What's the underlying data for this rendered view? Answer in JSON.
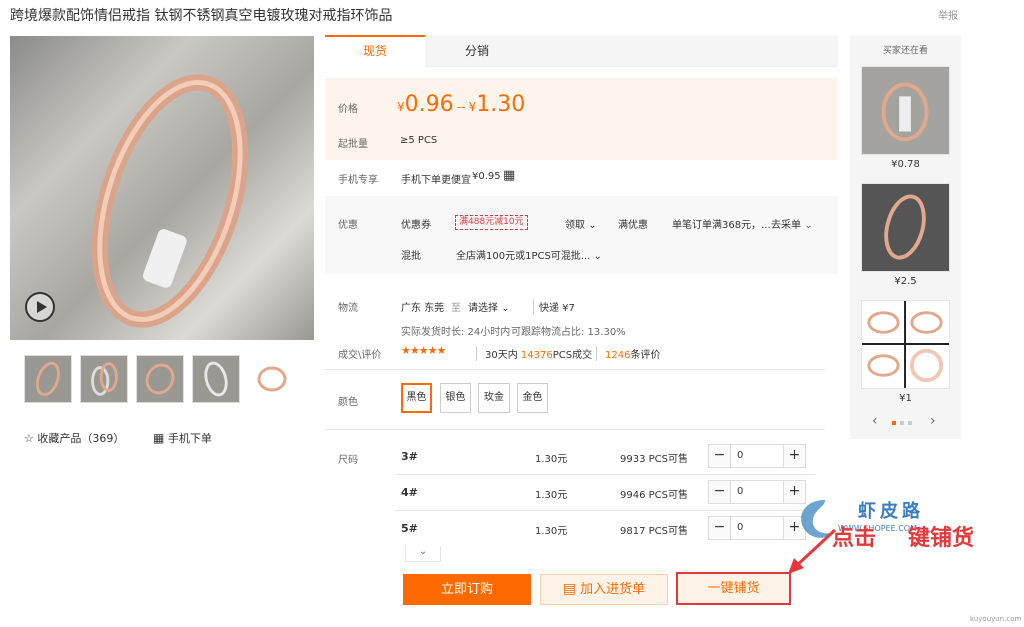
{
  "header": {
    "title": "跨境爆款配饰情侣戒指 钛钢不锈钢真空电镀玫瑰对戒指环饰品",
    "report": "举报"
  },
  "left": {
    "favorite": "收藏产品（369）",
    "mobile_order": "手机下单"
  },
  "tabs": {
    "spot": "现货",
    "distribution": "分销"
  },
  "price": {
    "label": "价格",
    "currency": "¥",
    "low": "0.96",
    "sep": "--",
    "high": "1.30",
    "moq_label": "起批量",
    "moq_value": "≥5 PCS"
  },
  "mobile": {
    "label": "手机专享",
    "text": "手机下单更便宜",
    "price": "¥0.95"
  },
  "promo": {
    "label": "优惠",
    "coupon_label": "优惠券",
    "coupon_tag": "满488元减10元",
    "receive": "领取",
    "discount_label": "满优惠",
    "discount_text": "单笔订单满368元，...",
    "purchase_link": "去采单",
    "mixed_label": "混批",
    "mixed_text": "全店满100元或1PCS可混批..."
  },
  "logistics": {
    "label": "物流",
    "origin": "广东 东莞",
    "to": "至",
    "select": "请选择",
    "express": "快递 ¥7",
    "detail1": "实际发货时长: 24小时内",
    "detail2": "可跟踪物流占比: 13.30%"
  },
  "sales": {
    "label": "成交\\评价",
    "stars": "★★★★★",
    "prefix": "30天内",
    "count": "14376",
    "suffix": "PCS成交",
    "reviews": "1246",
    "reviews_suffix": "条评价"
  },
  "colors": {
    "label": "颜色",
    "options": [
      "黑色",
      "银色",
      "玫金",
      "金色"
    ]
  },
  "sizes": {
    "label": "尺码",
    "rows": [
      {
        "size": "3#",
        "price": "1.30元",
        "stock": "9933 PCS可售",
        "qty": "0"
      },
      {
        "size": "4#",
        "price": "1.30元",
        "stock": "9946 PCS可售",
        "qty": "0"
      },
      {
        "size": "5#",
        "price": "1.30元",
        "stock": "9817 PCS可售",
        "qty": "0"
      }
    ]
  },
  "buttons": {
    "buy": "立即订购",
    "cart": "加入进货单",
    "one_key": "一键铺货"
  },
  "sidebar": {
    "title": "买家还在看",
    "prices": [
      "¥0.78",
      "¥2.5",
      "¥1"
    ]
  },
  "overlay": {
    "brand": "虾皮路",
    "brand_sub": "WWW.SHOPEE.COM",
    "caption_a": "点击",
    "caption_b": "键铺货"
  },
  "watermark": "kuyouyun.com",
  "accent": "#ff6a00"
}
